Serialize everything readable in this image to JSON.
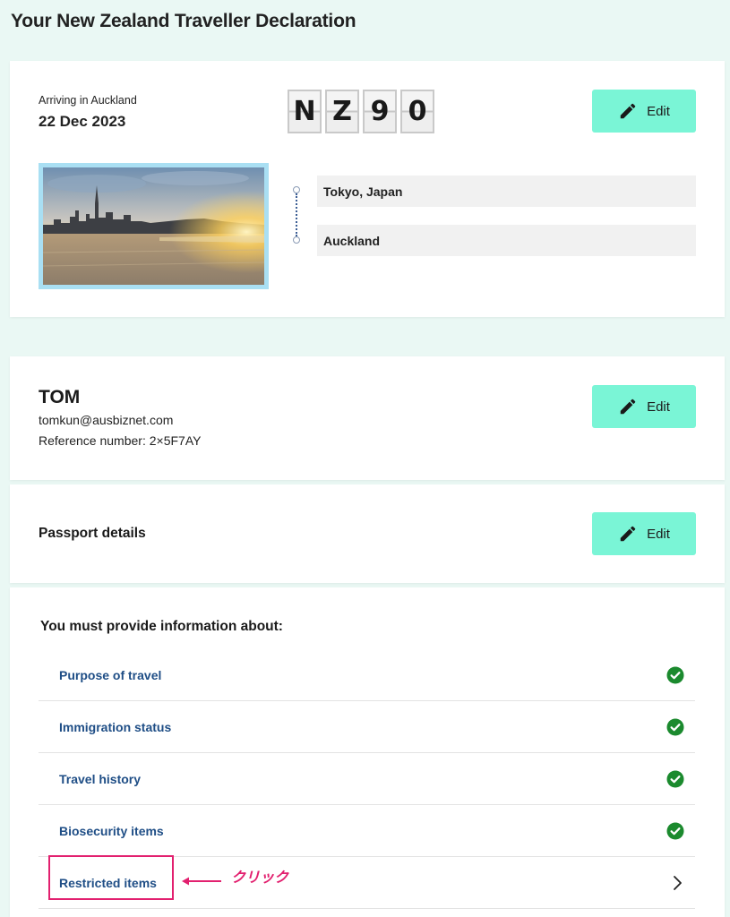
{
  "page": {
    "title": "Your New Zealand Traveller Declaration"
  },
  "trip": {
    "arriving_label": "Arriving in Auckland",
    "arrival_date": "22 Dec 2023",
    "flight_code_chars": [
      "N",
      "Z",
      "9",
      "0"
    ],
    "origin": "Tokyo, Japan",
    "destination": "Auckland",
    "edit_label": "Edit"
  },
  "traveller": {
    "name": "TOM",
    "email": "tomkun@ausbiznet.com",
    "reference": "Reference number: 2×5F7AY",
    "edit_label": "Edit"
  },
  "passport": {
    "title": "Passport details",
    "edit_label": "Edit"
  },
  "info": {
    "heading": "You must provide information about:",
    "items": [
      {
        "label": "Purpose of travel",
        "status": "check-icon"
      },
      {
        "label": "Immigration status",
        "status": "check-icon"
      },
      {
        "label": "Travel history",
        "status": "check-icon"
      },
      {
        "label": "Biosecurity items",
        "status": "check-icon"
      },
      {
        "label": "Restricted items",
        "status": "chevron-right-icon"
      }
    ]
  },
  "annotation": {
    "text": "クリック",
    "color": "#e2206f"
  },
  "colors": {
    "edit_button": "#7af5d6",
    "link": "#1f4e86",
    "check": "#1b8a2e",
    "photo_border": "#a9dff3"
  }
}
